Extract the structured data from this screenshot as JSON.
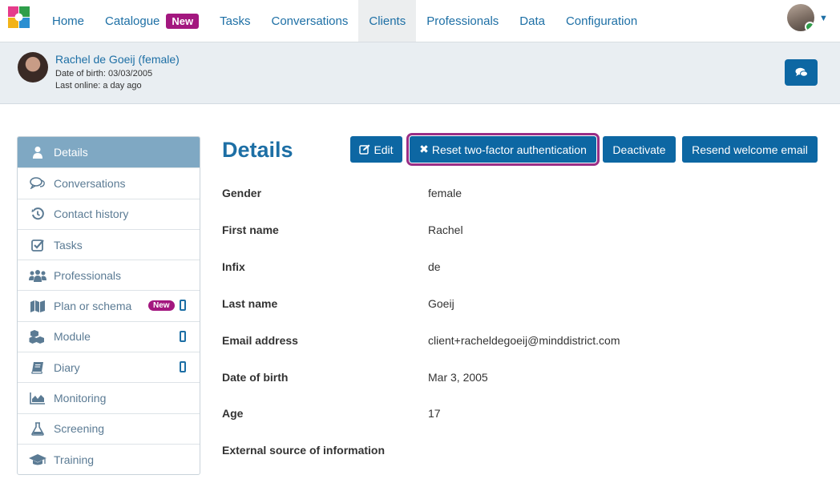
{
  "nav": {
    "items": [
      {
        "label": "Home"
      },
      {
        "label": "Catalogue",
        "badge": "New"
      },
      {
        "label": "Tasks"
      },
      {
        "label": "Conversations"
      },
      {
        "label": "Clients",
        "active": true
      },
      {
        "label": "Professionals"
      },
      {
        "label": "Data"
      },
      {
        "label": "Configuration"
      }
    ],
    "user_caret_icon": "caret-down-icon"
  },
  "client": {
    "name": "Rachel de Goeij (female)",
    "dob_line": "Date of birth: 03/03/2005",
    "last_online": "Last online: a day ago",
    "chat_icon": "chat-bubbles-icon"
  },
  "sidebar": {
    "items": [
      {
        "label": "Details",
        "icon": "user-icon",
        "active": true
      },
      {
        "label": "Conversations",
        "icon": "comments-icon"
      },
      {
        "label": "Contact history",
        "icon": "history-icon"
      },
      {
        "label": "Tasks",
        "icon": "checkbox-icon"
      },
      {
        "label": "Professionals",
        "icon": "users-icon"
      },
      {
        "label": "Plan or schema",
        "icon": "map-icon",
        "badge": "New",
        "mobile": true
      },
      {
        "label": "Module",
        "icon": "cubes-icon",
        "mobile": true
      },
      {
        "label": "Diary",
        "icon": "book-icon",
        "mobile": true
      },
      {
        "label": "Monitoring",
        "icon": "area-chart-icon"
      },
      {
        "label": "Screening",
        "icon": "flask-icon"
      },
      {
        "label": "Training",
        "icon": "graduation-cap-icon"
      }
    ]
  },
  "main": {
    "title": "Details",
    "buttons": {
      "edit": "Edit",
      "reset_2fa": "Reset two-factor authentication",
      "deactivate": "Deactivate",
      "resend": "Resend welcome email"
    },
    "fields": [
      {
        "label": "Gender",
        "value": "female"
      },
      {
        "label": "First name",
        "value": "Rachel"
      },
      {
        "label": "Infix",
        "value": "de"
      },
      {
        "label": "Last name",
        "value": "Goeij"
      },
      {
        "label": "Email address",
        "value": "client+racheldegoeij@minddistrict.com"
      },
      {
        "label": "Date of birth",
        "value": "Mar 3, 2005"
      },
      {
        "label": "Age",
        "value": "17"
      },
      {
        "label": "External source of information",
        "value": ""
      }
    ]
  },
  "colors": {
    "primary": "#0d67a3",
    "link": "#1d6fa5",
    "badge": "#a3177f",
    "sidebar_active": "#7fa8c3",
    "highlight_outline": "#9a2e86"
  }
}
